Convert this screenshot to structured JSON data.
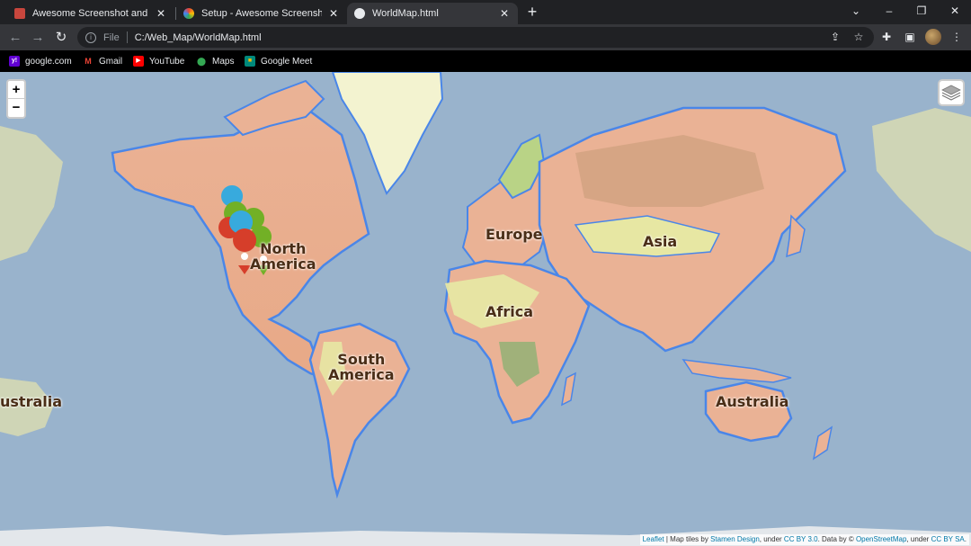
{
  "browser": {
    "tabs": [
      {
        "title": "Awesome Screenshot and Scree",
        "favicon_color": "#c8463d",
        "active": false
      },
      {
        "title": "Setup - Awesome Screenshot",
        "favicon_color": "#4b7bec",
        "active": false
      },
      {
        "title": "WorldMap.html",
        "favicon_color": "#e8eaed",
        "active": true
      }
    ],
    "new_tab": "+",
    "window_controls": {
      "dropdown": "⌄",
      "minimize": "–",
      "restore": "❐",
      "close": "✕"
    },
    "address": {
      "scheme_label": "File",
      "url": "C:/Web_Map/WorldMap.html"
    },
    "bookmarks": [
      {
        "label": "google.com",
        "icon": "yahoo-icon",
        "icon_char": "y!",
        "color": "#6001d2"
      },
      {
        "label": "Gmail",
        "icon": "gmail-icon",
        "icon_char": "M",
        "color": "#ea4335"
      },
      {
        "label": "YouTube",
        "icon": "youtube-icon",
        "icon_char": "▶",
        "color": "#ff0000"
      },
      {
        "label": "Maps",
        "icon": "maps-icon",
        "icon_char": "📍",
        "color": "#34a853"
      },
      {
        "label": "Google Meet",
        "icon": "meet-icon",
        "icon_char": "■",
        "color": "#00897b"
      }
    ]
  },
  "map": {
    "zoom_in": "+",
    "zoom_out": "−",
    "labels": {
      "north_america": "North\nAmerica",
      "europe": "Europe",
      "asia": "Asia",
      "africa": "Africa",
      "south_america": "South\nAmerica",
      "australia": "Australia",
      "australia_wrap": "ustralia"
    },
    "attribution": {
      "leaflet": "Leaflet",
      "map_tiles_by": " | Map tiles by ",
      "stamen": "Stamen Design",
      "under": ", under ",
      "cc_by": "CC BY 3.0",
      "data_by": ". Data by © ",
      "osm": "OpenStreetMap",
      "under2": ", under ",
      "cc_by_sa": "CC BY SA",
      "end": "."
    },
    "marker_colors": {
      "red": "#d63e2a",
      "green": "#72b026",
      "blue": "#38aadd"
    }
  }
}
